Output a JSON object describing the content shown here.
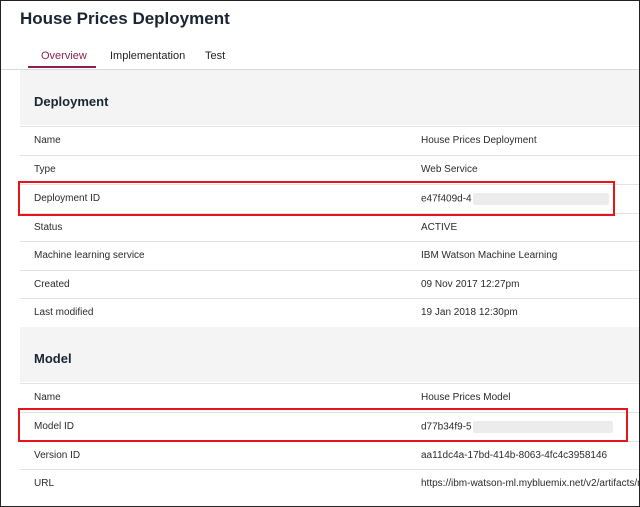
{
  "page": {
    "title": "House Prices Deployment"
  },
  "tabs": [
    {
      "label": "Overview",
      "active": true
    },
    {
      "label": "Implementation",
      "active": false
    },
    {
      "label": "Test",
      "active": false
    }
  ],
  "deployment": {
    "title": "Deployment",
    "rows": [
      {
        "label": "Name",
        "value": "House Prices Deployment"
      },
      {
        "label": "Type",
        "value": "Web Service"
      },
      {
        "label": "Deployment ID",
        "value": "e47f409d-4"
      },
      {
        "label": "Status",
        "value": "ACTIVE"
      },
      {
        "label": "Machine learning service",
        "value": "IBM Watson Machine Learning"
      },
      {
        "label": "Created",
        "value": "09 Nov 2017 12:27pm"
      },
      {
        "label": "Last modified",
        "value": "19 Jan 2018 12:30pm"
      }
    ]
  },
  "model": {
    "title": "Model",
    "rows": [
      {
        "label": "Name",
        "value": "House Prices Model"
      },
      {
        "label": "Model ID",
        "value": "d77b34f9-5"
      },
      {
        "label": "Version ID",
        "value": "aa11dc4a-17bd-414b-8063-4fc4c3958146"
      },
      {
        "label": "URL",
        "value": "https://ibm-watson-ml.mybluemix.net/v2/artifacts/m"
      }
    ]
  },
  "colors": {
    "accent": "#8a2252",
    "highlight": "#e8141c",
    "band": "#f4f4f4"
  }
}
